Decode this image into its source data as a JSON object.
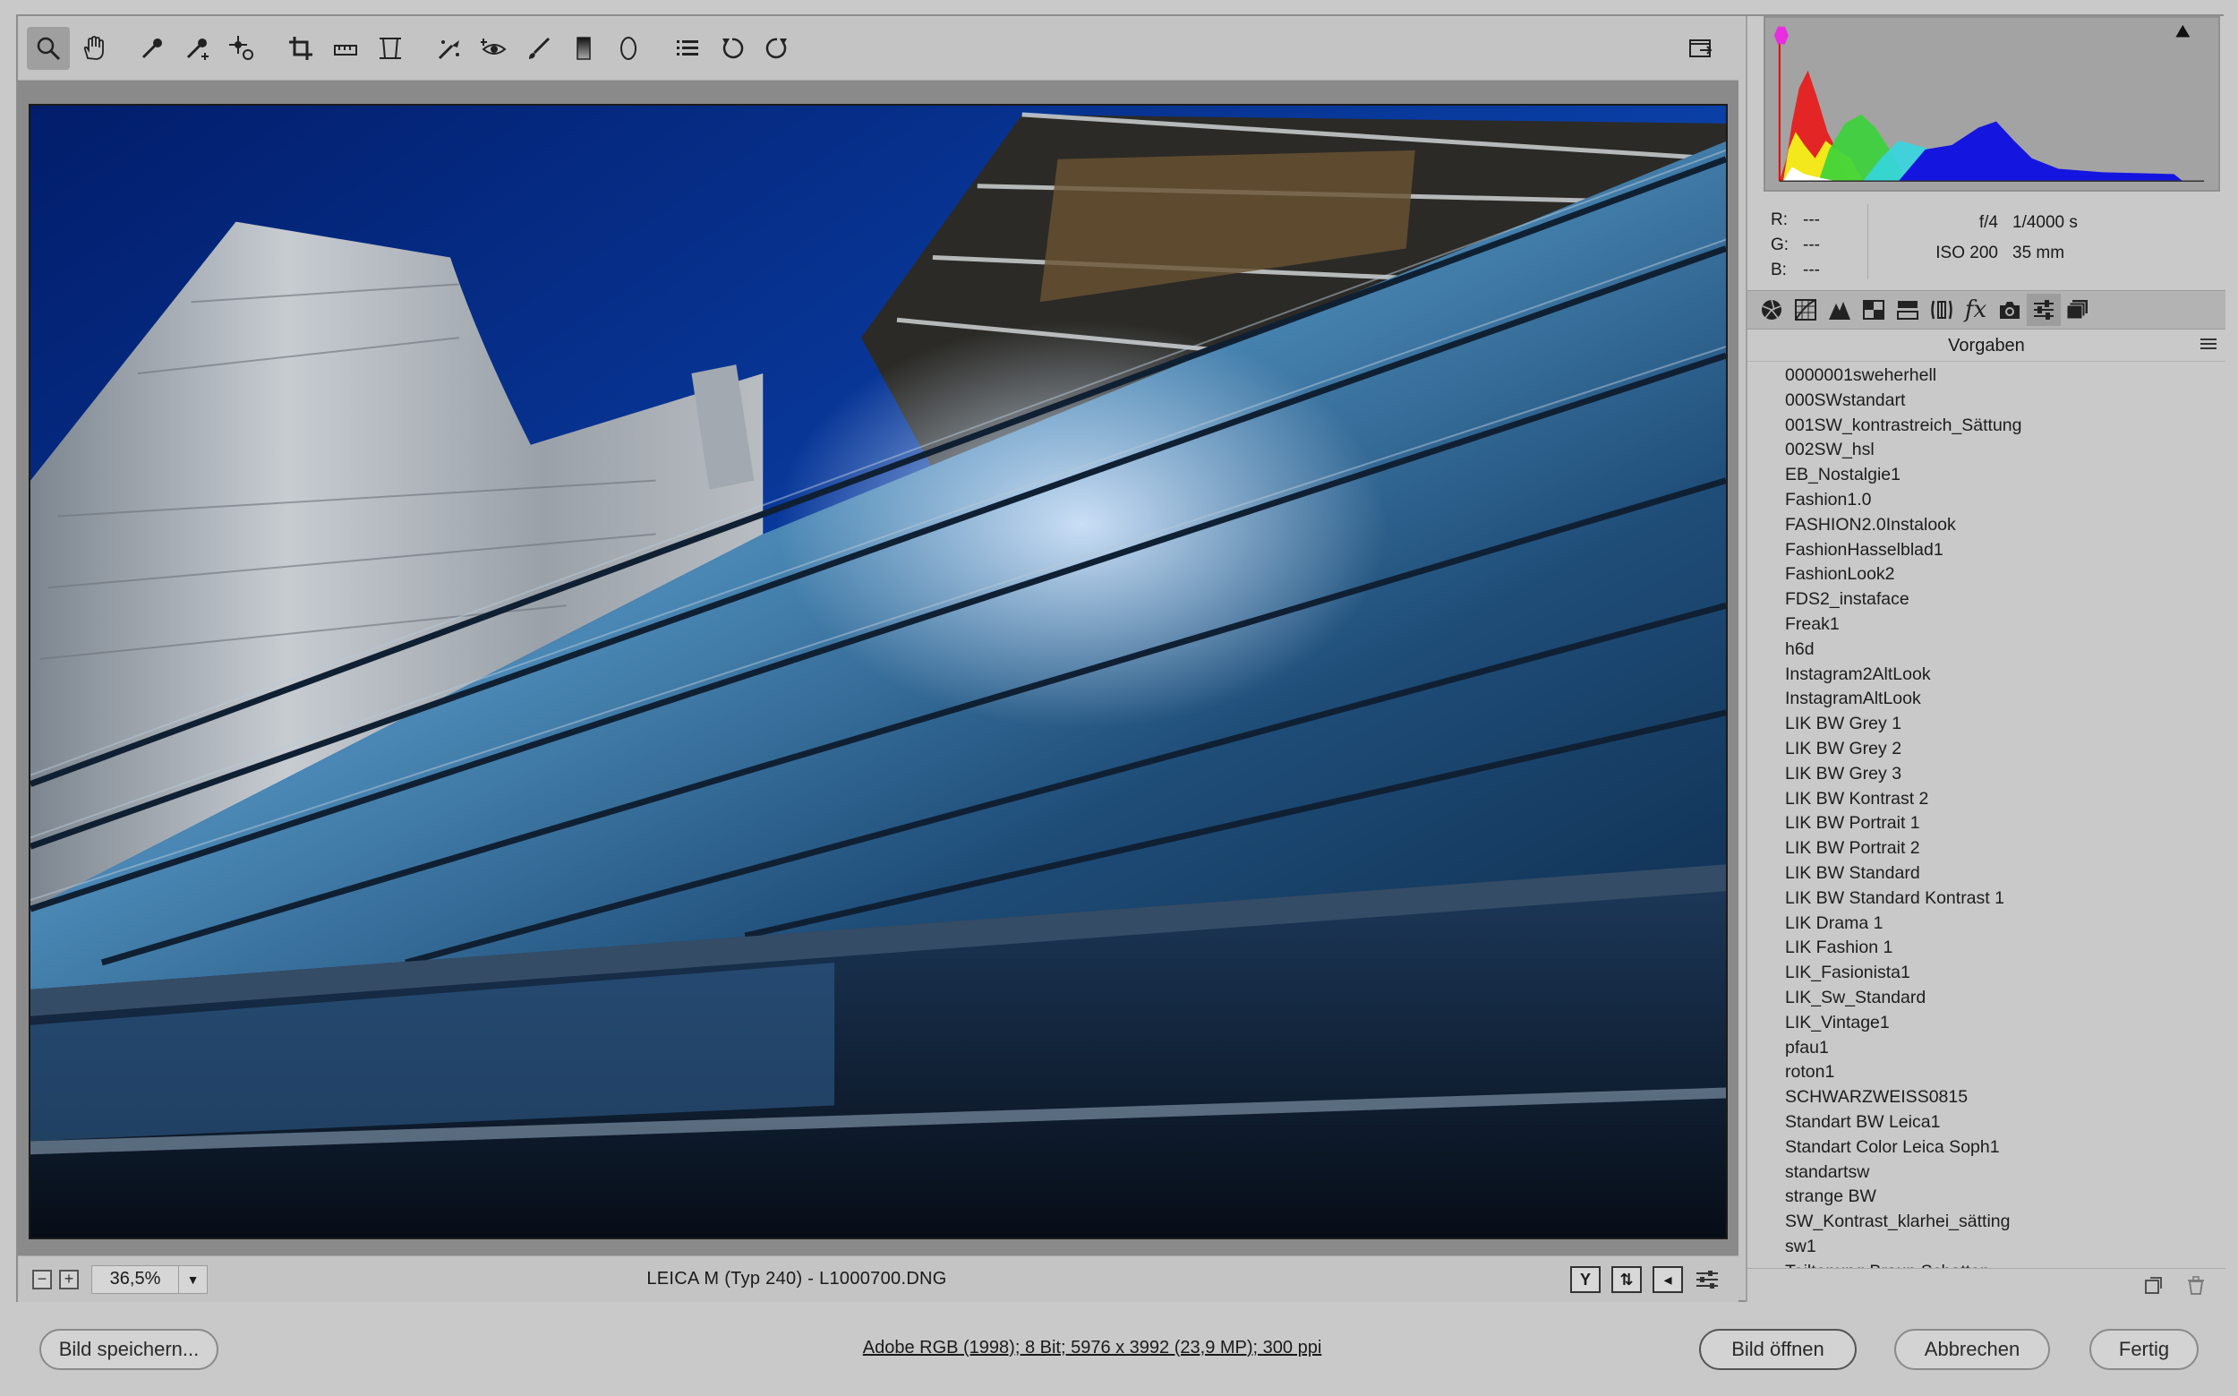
{
  "toolbar": {
    "tools": [
      "zoom-tool",
      "hand-tool",
      "white-balance-tool",
      "color-sampler-tool",
      "target-adjust-tool",
      "crop-tool",
      "straighten-tool",
      "transform-tool",
      "spot-removal-tool",
      "red-eye-tool",
      "adjustment-brush-tool",
      "graduated-filter-tool",
      "radial-filter-tool",
      "preferences-list",
      "rotate-left",
      "rotate-right"
    ],
    "right_tool": "toggle-fullscreen"
  },
  "status": {
    "zoom_value": "36,5%",
    "file_label": "LEICA M (Typ 240)  -  L1000700.DNG"
  },
  "info": {
    "r_label": "R:",
    "g_label": "G:",
    "b_label": "B:",
    "r_value": "---",
    "g_value": "---",
    "b_value": "---",
    "aperture": "f/4",
    "shutter": "1/4000 s",
    "iso": "ISO 200",
    "focal": "35 mm"
  },
  "panel": {
    "section_title": "Vorgaben",
    "presets": [
      "0000001sweherhell",
      "000SWstandart",
      "001SW_kontrastreich_Sättung",
      "002SW_hsl",
      "EB_Nostalgie1",
      "Fashion1.0",
      "FASHION2.0Instalook",
      "FashionHasselblad1",
      "FashionLook2",
      "FDS2_instaface",
      "Freak1",
      "h6d",
      "Instagram2AltLook",
      "InstagramAltLook",
      "LIK BW Grey 1",
      "LIK BW Grey 2",
      "LIK BW Grey 3",
      "LIK BW Kontrast 2",
      "LIK BW Portrait 1",
      "LIK BW Portrait 2",
      "LIK BW Standard",
      "LIK BW Standard Kontrast 1",
      "LIK Drama 1",
      "LIK Fashion 1",
      "LIK_Fasionista1",
      "LIK_Sw_Standard",
      "LIK_Vintage1",
      "pfau1",
      "roton1",
      "SCHWARZWEISS0815",
      "Standart BW Leica1",
      "Standart Color Leica Soph1",
      "standartsw",
      "strange BW",
      "SW_Kontrast_klarhei_sätting",
      "sw1",
      "Teiltonung Braun Schatten"
    ]
  },
  "footer": {
    "save_label": "Bild speichern...",
    "workflow_info": "Adobe RGB (1998); 8 Bit; 5976 x 3992 (23,9 MP); 300 ppi",
    "open_label": "Bild öffnen",
    "cancel_label": "Abbrechen",
    "done_label": "Fertig"
  },
  "colors": {
    "sky": "#0a3a9a",
    "glass": "#2f6b9e",
    "panel_bg": "#c9c9c9"
  }
}
